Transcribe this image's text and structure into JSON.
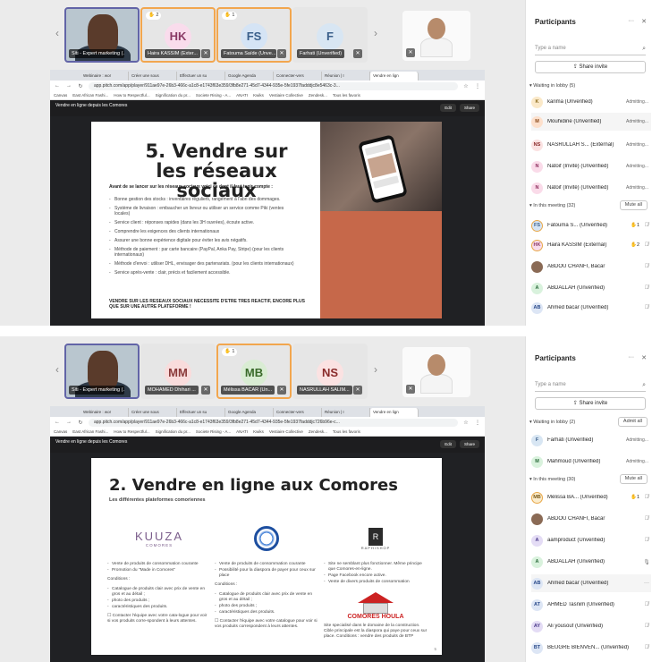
{
  "colors": {
    "accent": "#6264a7",
    "raise": "#f2a64e",
    "admit": "#424242"
  },
  "top": {
    "tiles": [
      {
        "name": "Siti - Expert marketing (...",
        "kind": "video"
      },
      {
        "name": "Haira KASSIM (Exter...",
        "initials": "HK",
        "hand": "2",
        "bg": "#f9dcec",
        "fg": "#8a3a66"
      },
      {
        "name": "Fatouma Saïde (Unve...",
        "initials": "FS",
        "hand": "1",
        "bg": "#d5e4f5",
        "fg": "#3a5f8a"
      },
      {
        "name": "Farhati (Unverified)",
        "initials": "F",
        "bg": "#d8e6f3",
        "fg": "#3a5f8a"
      }
    ],
    "browser": {
      "tabs": [
        "Webinaire : wor",
        "Créer une sous",
        "Effectuer un su",
        "Google Agenda",
        "Connecter-vers",
        "Réunion | I",
        "Vendre en lign"
      ],
      "url": "app.pitch.com/app/player/911ae97e-26b3-466c-a1c8-e1743f63e359/3fb8e271-45d7-4344-935e-5fe1937fadddjc8e5463c-3...",
      "bookmarks": [
        "Canvas",
        "East African Fashi...",
        "How to Respectful...",
        "Signification du pr...",
        "Societe Rising - A...",
        "ANATI",
        "Kwiks",
        "Vestiaire Collective",
        "Zendesk...",
        "Tous les favoris"
      ],
      "pitch_title": "Vendre en ligne depuis les Comores",
      "edit": "Edit",
      "share": "Share"
    },
    "slide": {
      "title": "5. Vendre sur les réseaux sociaux",
      "intro": "Avant de se lancer sur les réseaux sociaux voici ce dont il faut tenir compte :",
      "items": [
        "Bonne gestion des stocks : inventaires réguliers, rangement à l'abri des dommages.",
        "Système de livraison : embaucher un livreur ou utiliser un service comme Piki (ventes locales)",
        "Service client : réponses rapides (dans les 3H ouvrées), écoute active.",
        "Comprendre les exigences des clients internationaux",
        "Assurer une bonne expérience digitale pour éviter les avis négatifs.",
        "Méthode de paiement : par carte bancaire (PayPal, Anka Pay, Stripe) (pour les clients internationaux)",
        "Méthode d'envoi : utiliser DHL, envisager des partenariats. (pour les clients internationaux)",
        "Service après-vente : clair, précis et facilement accessible."
      ],
      "footer": "VENDRE SUR LES RESEAUX SOCIAUX NECESSITE D'ETRE TRES REACTIF, ENCORE PLUS QUE SUR UNE AUTRE PLATEFORME !"
    },
    "panel": {
      "title": "Participants",
      "search_placeholder": "Type a name",
      "share_invite": "Share invite",
      "lobby_label": "Waiting in lobby (5)",
      "lobby": [
        {
          "initial": "K",
          "name": "karima (Unverified)",
          "status": "Admitting...",
          "bg": "#fbe9c9",
          "fg": "#8a6a1a"
        },
        {
          "initial": "M",
          "name": "Mouhidine (Unverified)",
          "status": "Admitting...",
          "bg": "#fde0cc",
          "fg": "#8a4a1a"
        },
        {
          "initial": "NS",
          "name": "NASRULLAH S... (External)",
          "status": "Admitting...",
          "bg": "#fbe2e2",
          "fg": "#8a2a2a"
        },
        {
          "initial": "N",
          "name": "Natoif (Invité) (Unverified)",
          "status": "Admitting...",
          "bg": "#fadbe9",
          "fg": "#8a2a5a"
        },
        {
          "initial": "N",
          "name": "Natoif (Invité) (Unverified)",
          "status": "Admitting...",
          "bg": "#fadbe9",
          "fg": "#8a2a5a"
        }
      ],
      "meeting_label": "In this meeting (32)",
      "mute_all": "Mute all",
      "meeting": [
        {
          "initial": "FS",
          "name": "Fatouma S... (Unverified)",
          "hand": "1",
          "icon": "mic-off",
          "bg": "#d5e4f5",
          "fg": "#3a5f8a",
          "ring": true
        },
        {
          "initial": "HK",
          "name": "Haira KASSIM (External)",
          "hand": "2",
          "icon": "mic-off",
          "bg": "#f9dcec",
          "fg": "#8a3a66",
          "ring": true
        },
        {
          "initial": "",
          "name": "ABDOU CHANFI, Bacar",
          "icon": "mic-off",
          "photo": true
        },
        {
          "initial": "A",
          "name": "ABDALLAH (Unverified)",
          "icon": "mic-off",
          "bg": "#d9f2dd",
          "fg": "#2a6a3a"
        },
        {
          "initial": "AB",
          "name": "Ahmed bacar (Unverified)",
          "icon": "mic-off",
          "bg": "#dde6f5",
          "fg": "#2a4a8a"
        }
      ]
    }
  },
  "bottom": {
    "tiles": [
      {
        "name": "Siti - Expert marketing (...",
        "kind": "video"
      },
      {
        "name": "MOHAMED Dhihari ...",
        "initials": "MM",
        "bg": "#f9dcdc",
        "fg": "#8a3a3a"
      },
      {
        "name": "Mélissa BACAR (Un...",
        "initials": "MB",
        "hand": "1",
        "bg": "#d9ecd3",
        "fg": "#3a6a2a"
      },
      {
        "name": "NASRULLAH SALIM...",
        "initials": "NS",
        "bg": "#fbe2e2",
        "fg": "#8a2a2a"
      }
    ],
    "browser": {
      "url": "app.pitch.com/app/player/911ae97e-26b3-466c-a1c8-e1743f63e359/3fb8e271-45d7-4344-935e-5fe1937fadddjc726b96e-c...",
      "pitch_title": "Vendre en ligne depuis les Comores"
    },
    "slide": {
      "title": "2. Vendre en ligne aux Comores",
      "subtitle": "Les différentes plateformes comoriennes",
      "kuuza": "KUUZA",
      "kuuza_sub": "COMORES",
      "rs_letter": "R",
      "rs_text": "RAPHISHOP",
      "col1": [
        "Vente de produits de consommation courante",
        "Promotion du \"Made in Comores\""
      ],
      "col1_cond": "Conditions :",
      "col1_conds": [
        "Catalogue de produits clair avec prix de vente en gros et au détail ;",
        "photo des produits ;",
        "caractéristiques des produits."
      ],
      "col1_contact": "Contacter l'équipe avec votre cata-logue pour voir si vos produits corre-spondent à leurs attentes.",
      "col2": [
        "Vente de produits de consommation courante",
        "Possibilité pour la diaspora de payer pour ceux sur place"
      ],
      "col2_cond": "Conditions :",
      "col2_conds": [
        "Catalogue de produits clair avec prix de vente en gros et au détail ;",
        "photo des produits ;",
        "caractéristiques des produits."
      ],
      "col2_contact": "Contacter l'équipe avec votre catalogue pour voir si vos produits correspondent à leurs attentes.",
      "col3": [
        "Site ne semblant plus fonctionner. Même principe que Comores-en-ligne.",
        "Page Facebook encore active.",
        "Vente de divers produits de consommation"
      ],
      "houla": "COMORES HOULA",
      "col3_text": "Site specialisé dans le domaine de la construction. Cible principale est la diaspora qui paye pour ceux sur place. Conditions : vendre des produits de BTP",
      "page": "5"
    },
    "panel": {
      "lobby_label": "Waiting in lobby (2)",
      "admit_all": "Admit all",
      "lobby": [
        {
          "initial": "F",
          "name": "Farhati (Unverified)",
          "status": "Admitting...",
          "bg": "#d8e6f3",
          "fg": "#3a5f8a"
        },
        {
          "initial": "M",
          "name": "Mahmoud (Unverified)",
          "status": "Admitting...",
          "bg": "#d9f2dd",
          "fg": "#2a6a3a"
        }
      ],
      "meeting_label": "In this meeting (30)",
      "mute_all": "Mute all",
      "meeting": [
        {
          "initial": "MB",
          "name": "Mélissa BA... (Unverified)",
          "hand": "1",
          "icon": "mic-off",
          "bg": "#fbeccc",
          "fg": "#7a5a1a",
          "ring": true
        },
        {
          "initial": "",
          "name": "ABDOU CHANFI, Bacar",
          "icon": "mic-off",
          "photo": true
        },
        {
          "initial": "A",
          "name": "aamproduct (Unverified)",
          "icon": "mic-off",
          "bg": "#e4dcf5",
          "fg": "#4a3a8a"
        },
        {
          "initial": "A",
          "name": "ABDALLAH (Unverified)",
          "icon": "mic-on",
          "bg": "#d9f2dd",
          "fg": "#2a6a3a"
        },
        {
          "initial": "AB",
          "name": "Ahmed bacar (Unverified)",
          "icon": "more",
          "bg": "#dde6f5",
          "fg": "#2a4a8a"
        },
        {
          "initial": "AT",
          "name": "AHMED Tasnim (Unverified)",
          "icon": "mic-off",
          "bg": "#dde6f5",
          "fg": "#2a4a8a"
        },
        {
          "initial": "AY",
          "name": "Ali yousouf (Unverified)",
          "icon": "mic-off",
          "bg": "#e4dcf5",
          "fg": "#4a3a8a"
        },
        {
          "initial": "BT",
          "name": "BEUGRE BIENVEN... (Unverified)",
          "icon": "mic-off",
          "bg": "#dde6f5",
          "fg": "#2a4a8a"
        }
      ]
    }
  }
}
